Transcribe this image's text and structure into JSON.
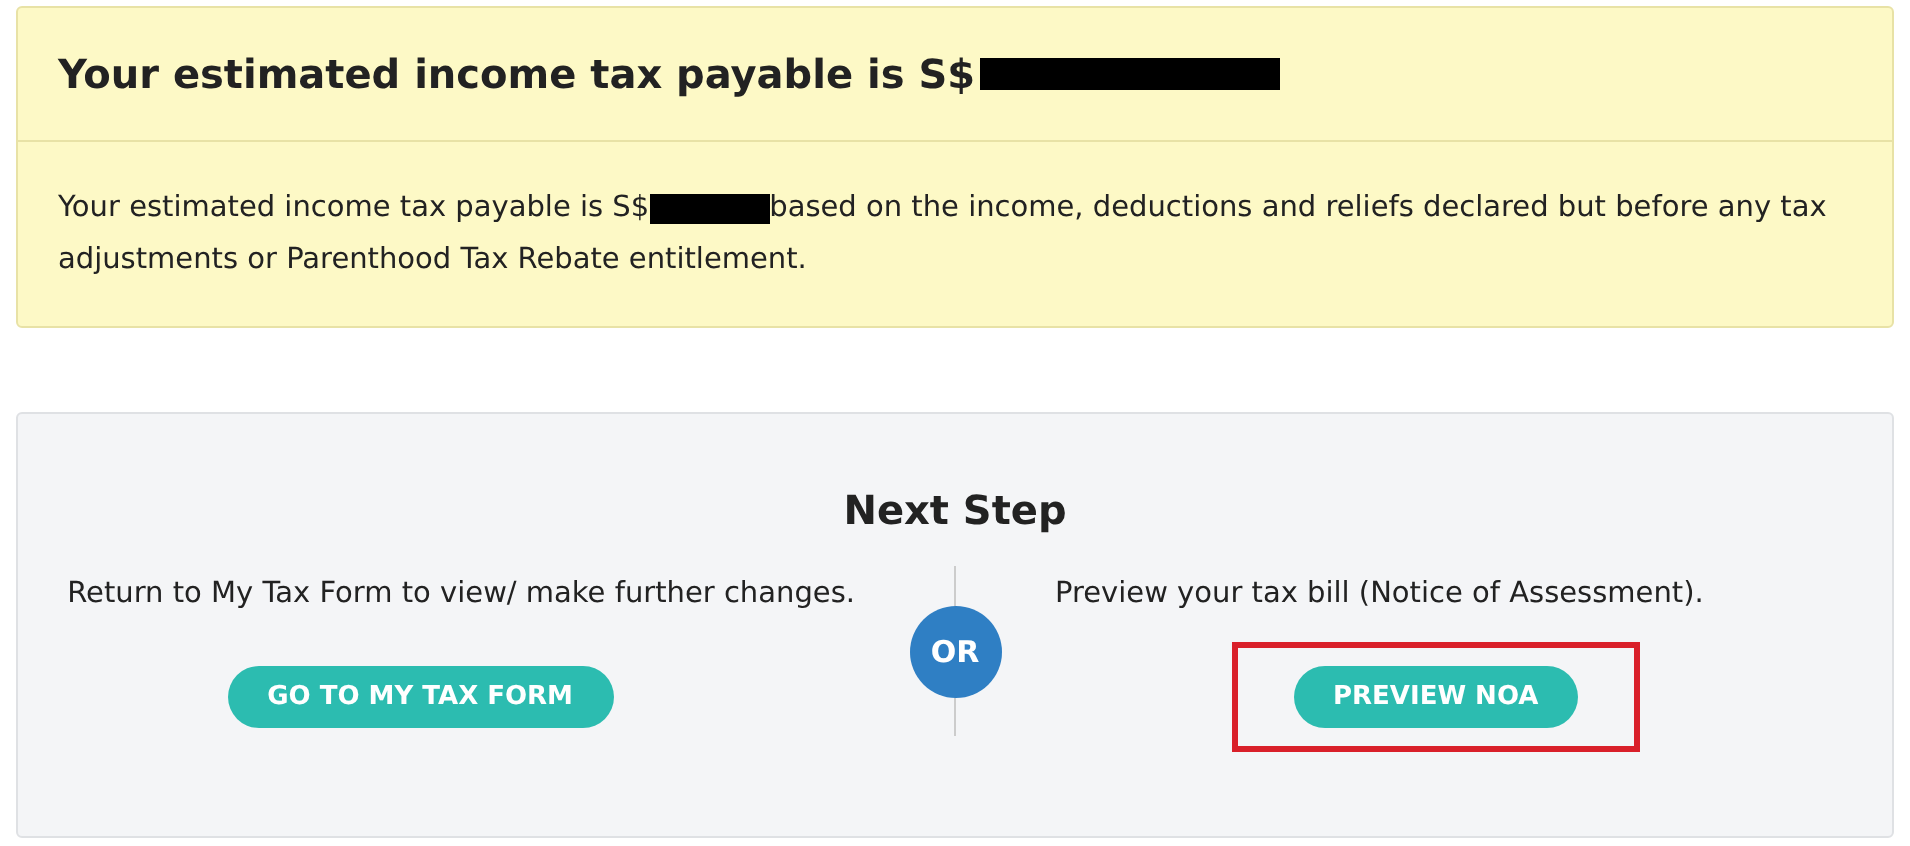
{
  "summary": {
    "title": "Your estimated income tax payable is S$",
    "title_redacted": true,
    "body_before": "Your estimated income tax payable is S$",
    "body_redacted": true,
    "body_after": "based on the income, deductions and reliefs declared but before any tax adjustments or Parenthood Tax Rebate entitlement."
  },
  "next_step": {
    "heading": "Next Step",
    "divider_label": "OR",
    "options": [
      {
        "text": "Return to My Tax Form to view/ make further changes.",
        "button": "GO TO MY TAX FORM",
        "highlighted": false
      },
      {
        "text": "Preview your tax bill (Notice of Assessment).",
        "button": "PREVIEW NOA",
        "highlighted": true
      }
    ]
  }
}
